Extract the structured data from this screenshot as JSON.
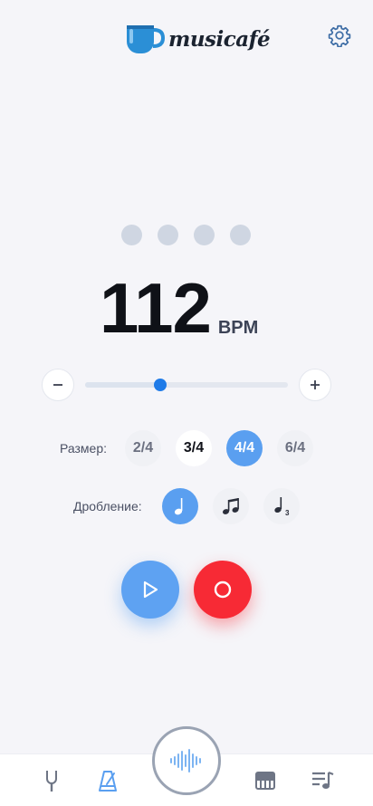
{
  "header": {
    "logo_text": "musicafé"
  },
  "bpm": {
    "value": "112",
    "unit": "BPM"
  },
  "tempo_slider": {
    "value": 112,
    "level": 0.37
  },
  "meter": {
    "label": "Размер:",
    "options": [
      "2/4",
      "3/4",
      "4/4",
      "6/4"
    ],
    "selected": "4/4"
  },
  "subdivision": {
    "label": "Дробление:",
    "options": [
      "quarter-note-icon",
      "eighth-notes-icon",
      "triplet-icon"
    ],
    "selected": "quarter-note-icon",
    "triplet_mark": "3"
  },
  "beat_indicators": 4,
  "colors": {
    "accent": "#5a9ff0",
    "record": "#f72a35",
    "slider_thumb": "#1f7be8"
  }
}
